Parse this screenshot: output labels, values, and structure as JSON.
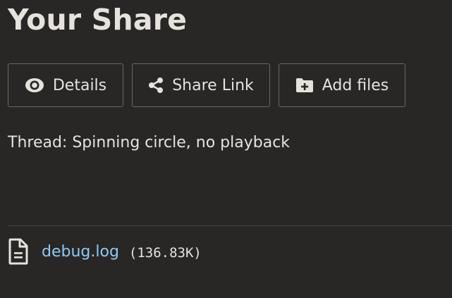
{
  "page": {
    "title": "Your Share"
  },
  "toolbar": {
    "details": {
      "label": "Details",
      "icon": "eye-icon"
    },
    "share_link": {
      "label": "Share Link",
      "icon": "share-icon"
    },
    "add_files": {
      "label": "Add files",
      "icon": "folder-plus-icon"
    }
  },
  "share": {
    "description": "Thread: Spinning circle, no playback"
  },
  "files": [
    {
      "name": "debug.log",
      "size": "(136.83K)",
      "icon": "file-text-icon"
    }
  ],
  "colors": {
    "background": "#292626",
    "text": "#e6e2dc",
    "link": "#8fcaf2",
    "border": "#6b6764"
  }
}
